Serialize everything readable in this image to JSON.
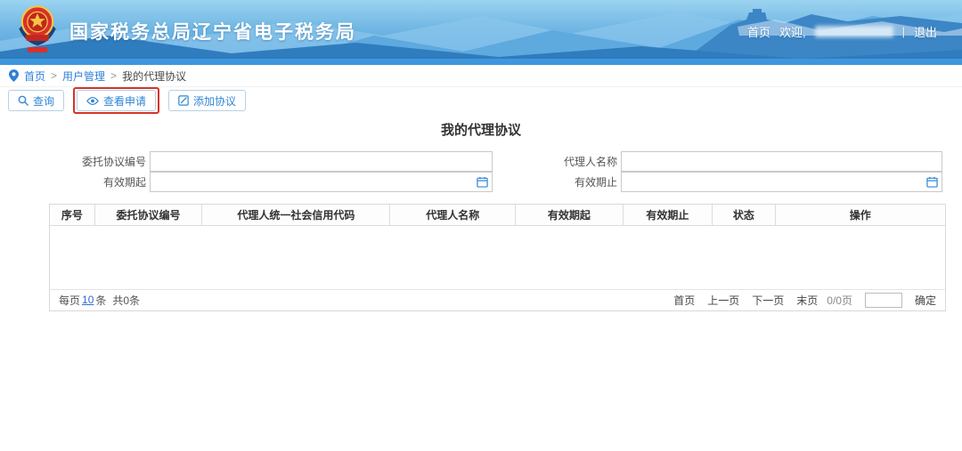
{
  "header": {
    "title": "国家税务总局辽宁省电子税务局",
    "nav": {
      "home": "首页",
      "welcome": "欢迎,",
      "separator": "|",
      "logout": "退出"
    }
  },
  "breadcrumb": {
    "separator": ">",
    "items": [
      {
        "label": "首页"
      },
      {
        "label": "用户管理"
      },
      {
        "label": "我的代理协议"
      }
    ]
  },
  "toolbar": {
    "query_label": "查询",
    "view_application_label": "查看申请",
    "add_agreement_label": "添加协议"
  },
  "main": {
    "title": "我的代理协议",
    "form": {
      "fields": {
        "agreement_no": {
          "label": "委托协议编号",
          "value": ""
        },
        "agent_name": {
          "label": "代理人名称",
          "value": ""
        },
        "valid_from": {
          "label": "有效期起",
          "value": ""
        },
        "valid_to": {
          "label": "有效期止",
          "value": ""
        }
      }
    },
    "table": {
      "columns": [
        "序号",
        "委托协议编号",
        "代理人统一社会信用代码",
        "代理人名称",
        "有效期起",
        "有效期止",
        "状态",
        "操作"
      ],
      "rows": []
    },
    "pagination": {
      "per_page_prefix": "每页",
      "per_page_size": "10",
      "per_page_suffix": "条",
      "total_label": "共0条",
      "first": "首页",
      "prev": "上一页",
      "next": "下一页",
      "last": "末页",
      "page_indicator": "0/0页",
      "jump_value": "",
      "confirm": "确定"
    }
  },
  "colors": {
    "banner_blue": "#4f9fdb",
    "accent_blue": "#2f86d6",
    "link_blue": "#2f7fd6",
    "annotation_red": "#d3342b",
    "border_gray": "#d9d9d9"
  }
}
